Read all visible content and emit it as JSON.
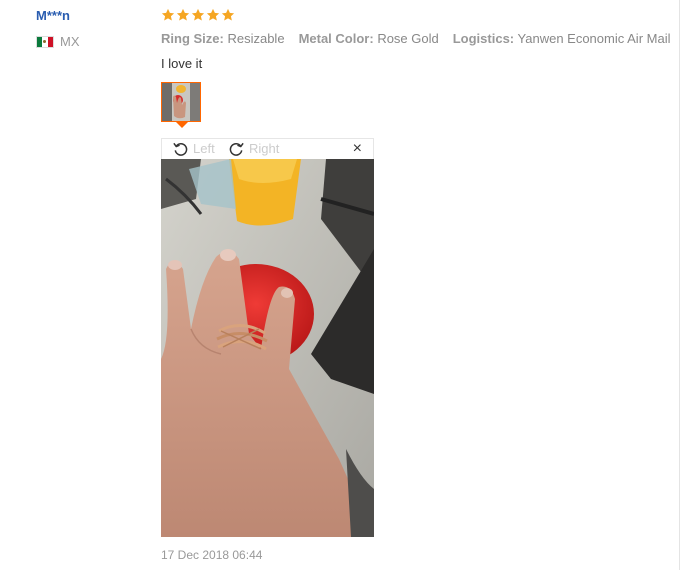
{
  "reviewer": {
    "name": "M***n",
    "country_code": "MX",
    "flag_icon": "mexico-flag-icon"
  },
  "rating": {
    "stars": 5,
    "max": 5,
    "star_color": "#f5a623"
  },
  "attributes": [
    {
      "key": "Ring Size:",
      "value": "Resizable"
    },
    {
      "key": "Metal Color:",
      "value": "Rose Gold"
    },
    {
      "key": "Logistics:",
      "value": "Yanwen Economic Air Mail"
    }
  ],
  "review": {
    "text": "I love it"
  },
  "viewer": {
    "rotate_left_label": "Left",
    "rotate_right_label": "Right",
    "rotate_left_icon": "rotate-left-icon",
    "rotate_right_icon": "rotate-right-icon",
    "close_label": "×",
    "accent_color": "#ff6600"
  },
  "timestamp": "17 Dec 2018 06:44"
}
